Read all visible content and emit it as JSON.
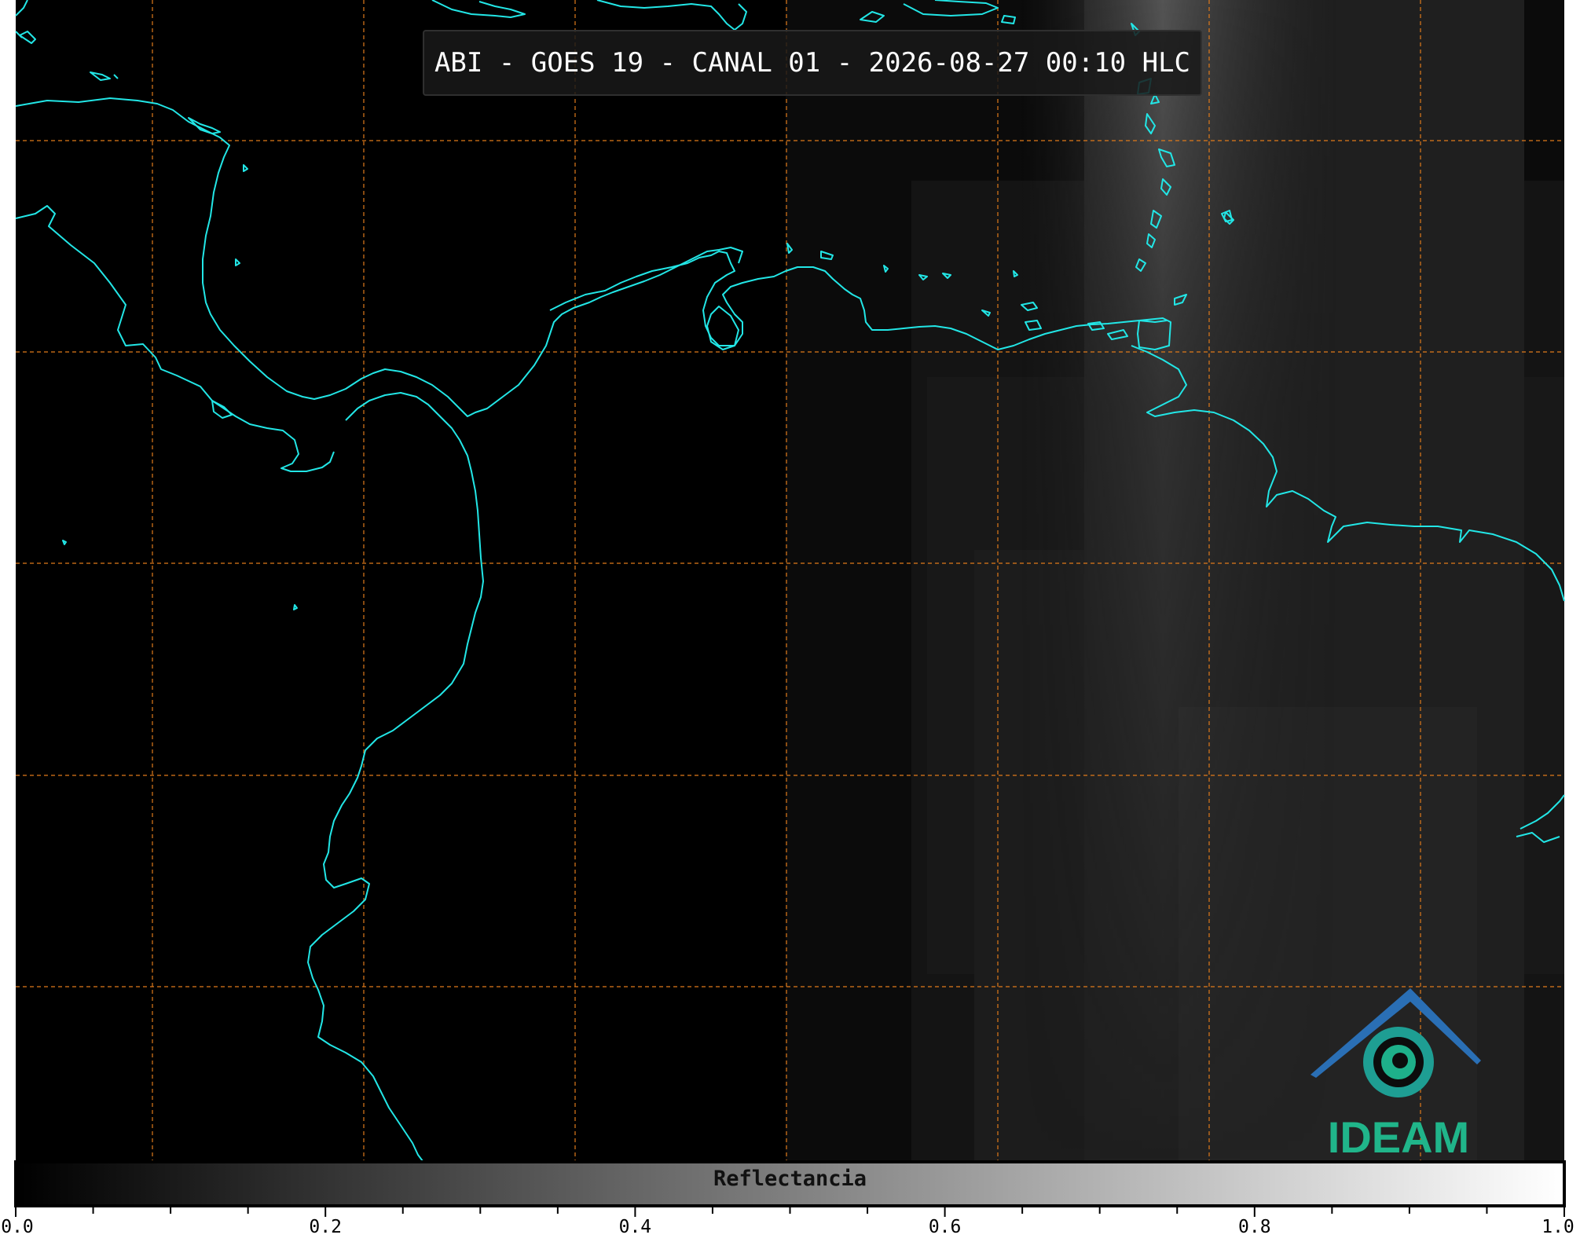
{
  "title": "ABI - GOES 19 - CANAL 01 - 2026-08-27 00:10 HLC",
  "colorbar": {
    "label": "Reflectancia",
    "range": [
      0.0,
      1.0
    ],
    "ticks": [
      "0.0",
      "0.2",
      "0.4",
      "0.6",
      "0.8",
      "1.0"
    ]
  },
  "logo": {
    "text": "IDEAM"
  },
  "colors": {
    "coastline": "#22e6e6",
    "gridlines": "#e07a1a",
    "background": "#000000",
    "logo_green": "#20b58a",
    "logo_blue": "#2a6fb5"
  }
}
